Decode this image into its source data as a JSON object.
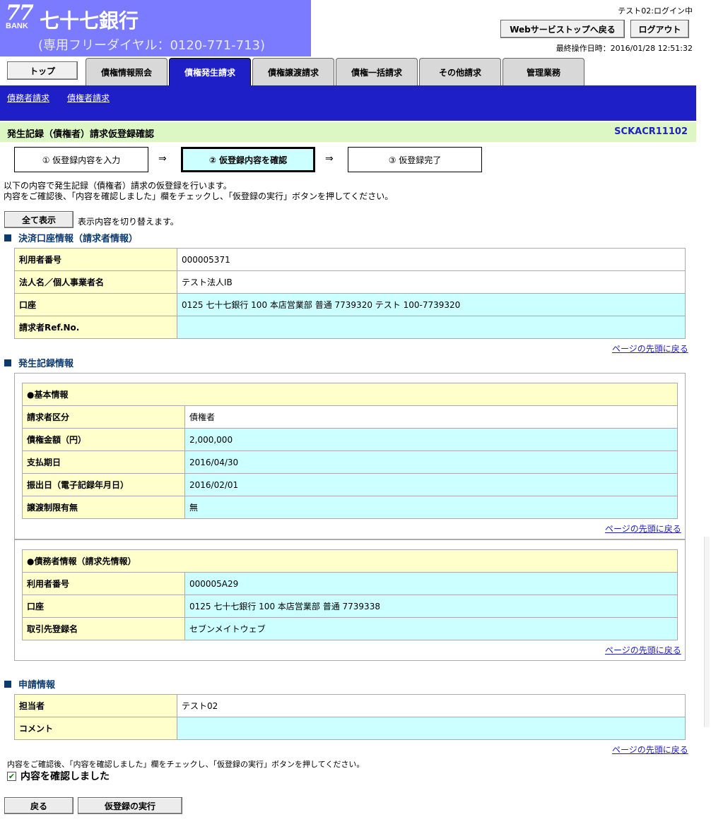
{
  "header": {
    "logo_number": "77",
    "logo_bank": "BANK",
    "bank_name": "七十七銀行",
    "dial": "(専用フリーダイヤル：0120-771-713)",
    "login_status": "テスト02:ログイン中",
    "portal_button": "Webサービストップへ戻る",
    "logout_button": "ログアウト",
    "last_operation": "最終操作日時：2016/01/28 12:51:32"
  },
  "tabs": {
    "top": "トップ",
    "items": [
      {
        "label": "債権情報照会"
      },
      {
        "label": "債権発生請求"
      },
      {
        "label": "債権譲渡請求"
      },
      {
        "label": "債権一括請求"
      },
      {
        "label": "その他請求"
      },
      {
        "label": "管理業務"
      }
    ]
  },
  "subnav": {
    "items": [
      "債務者請求",
      "債権者請求"
    ]
  },
  "title": {
    "text": "発生記録（債権者）請求仮登録確認",
    "screen_id": "SCKACR11102"
  },
  "steps": {
    "items": [
      "① 仮登録内容を入力",
      "② 仮登録内容を確認",
      "③ 仮登録完了"
    ],
    "arrow": "⇒",
    "active_index": 1
  },
  "intro": {
    "line1": "以下の内容で発生記録（債権者）請求の仮登録を行います。",
    "line2": "内容をご確認後、「内容を確認しました」欄をチェックし、「仮登録の実行」ボタンを押してください。"
  },
  "toggle": {
    "button": "全て表示",
    "note": "表示内容を切り替えます。"
  },
  "section1": {
    "title": "決済口座情報（請求者情報）",
    "rows": [
      {
        "label": "利用者番号",
        "value": "000005371"
      },
      {
        "label": "法人名／個人事業者名",
        "value": "テスト法人IB"
      },
      {
        "label": "口座",
        "value": "0125 七十七銀行 100 本店営業部 普通 7739320 テスト 100-7739320"
      },
      {
        "label": "請求者Ref.No.",
        "value": ""
      }
    ]
  },
  "page_top_link": "ページの先頭に戻る",
  "section2": {
    "title": "発生記録情報",
    "basic": {
      "heading": "●基本情報",
      "rows": [
        {
          "label": "請求者区分",
          "value": "債権者"
        },
        {
          "label": "債権金額（円）",
          "value": "2,000,000"
        },
        {
          "label": "支払期日",
          "value": "2016/04/30"
        },
        {
          "label": "振出日（電子記録年月日）",
          "value": "2016/02/01"
        },
        {
          "label": "譲渡制限有無",
          "value": "無"
        }
      ]
    },
    "debtor": {
      "heading": "●債務者情報（請求先情報）",
      "rows": [
        {
          "label": "利用者番号",
          "value": "000005A29"
        },
        {
          "label": "口座",
          "value": "0125 七十七銀行 100 本店営業部 普通 7739338"
        },
        {
          "label": "取引先登録名",
          "value": "セブンメイトウェブ"
        }
      ]
    }
  },
  "section3": {
    "title": "申請情報",
    "rows": [
      {
        "label": "担当者",
        "value": "テスト02"
      },
      {
        "label": "コメント",
        "value": ""
      }
    ]
  },
  "confirm": {
    "note": "内容をご確認後、「内容を確認しました」欄をチェックし、「仮登録の実行」ボタンを押してください。",
    "checkbox_label": "内容を確認しました",
    "checked": true
  },
  "footer": {
    "back_button": "戻る",
    "execute_button": "仮登録の実行"
  },
  "colors": {
    "brand": "#7b7bff",
    "nav": "#1f1fc8",
    "title_bar": "#dcf7c4",
    "label_cell": "#ffffcc",
    "value_cell": "#ccffff"
  }
}
